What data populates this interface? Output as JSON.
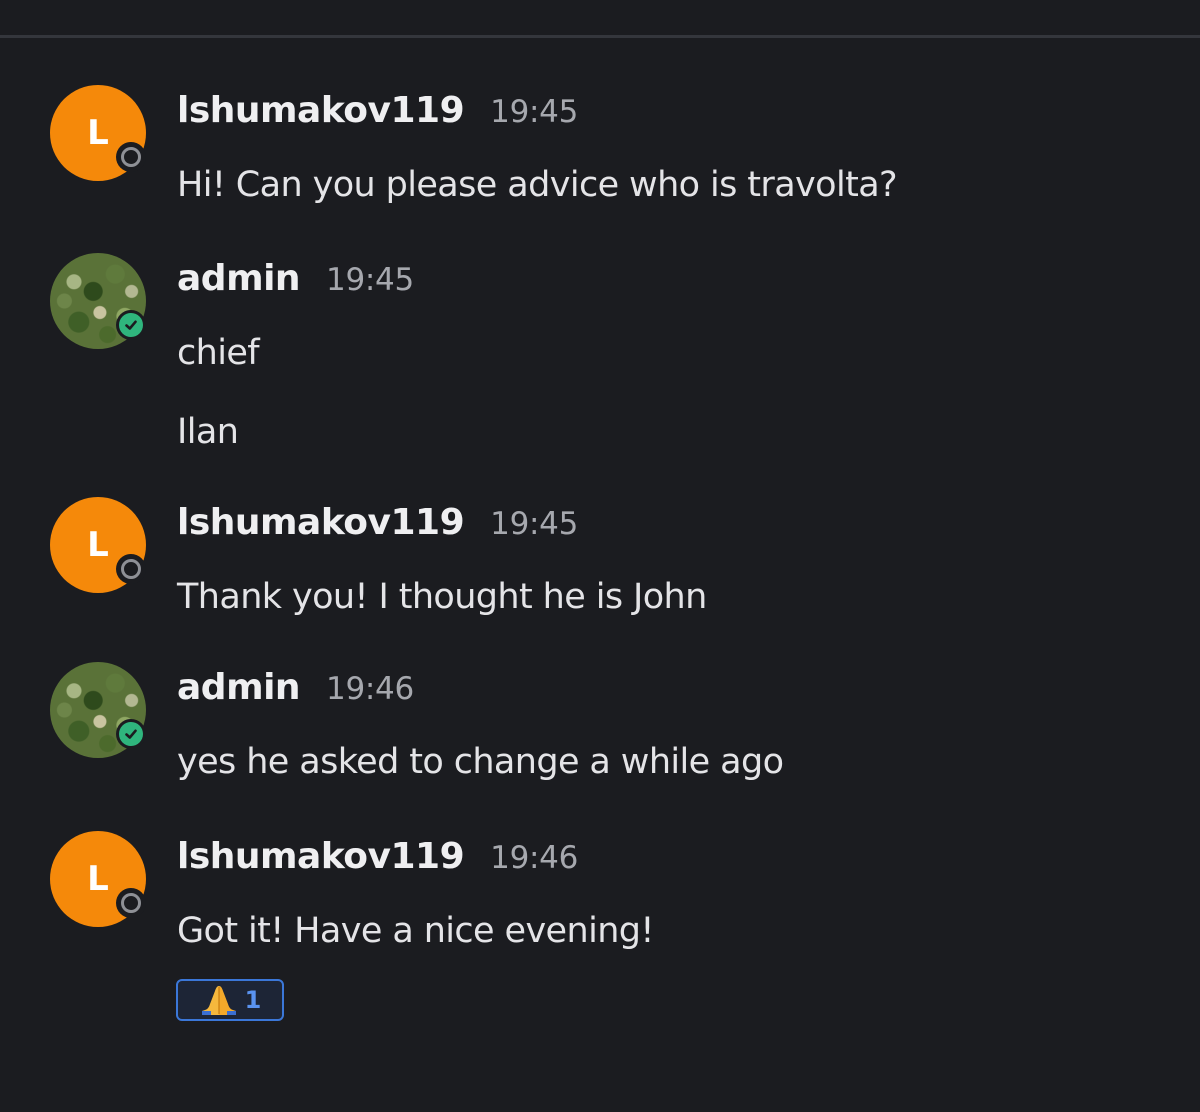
{
  "messages": [
    {
      "author": "lshumakov119",
      "avatar_letter": "L",
      "status": "offline",
      "time": "19:45",
      "lines": [
        "Hi! Can you please advice who is travolta?"
      ]
    },
    {
      "author": "admin",
      "avatar_letter": "",
      "status": "online",
      "time": "19:45",
      "lines": [
        "chief",
        "Ilan"
      ]
    },
    {
      "author": "lshumakov119",
      "avatar_letter": "L",
      "status": "offline",
      "time": "19:45",
      "lines": [
        "Thank you! I thought he is John"
      ]
    },
    {
      "author": "admin",
      "avatar_letter": "",
      "status": "online",
      "time": "19:46",
      "lines": [
        "yes he asked to change a while ago"
      ]
    },
    {
      "author": "lshumakov119",
      "avatar_letter": "L",
      "status": "offline",
      "time": "19:46",
      "lines": [
        "Got it! Have a nice evening!"
      ],
      "reaction": {
        "icon": "folded-hands-icon",
        "count": "1"
      }
    }
  ],
  "colors": {
    "background": "#1b1c20",
    "avatar_orange": "#f5890a",
    "online_green": "#2fb57d",
    "reaction_border": "#3b77d8"
  }
}
